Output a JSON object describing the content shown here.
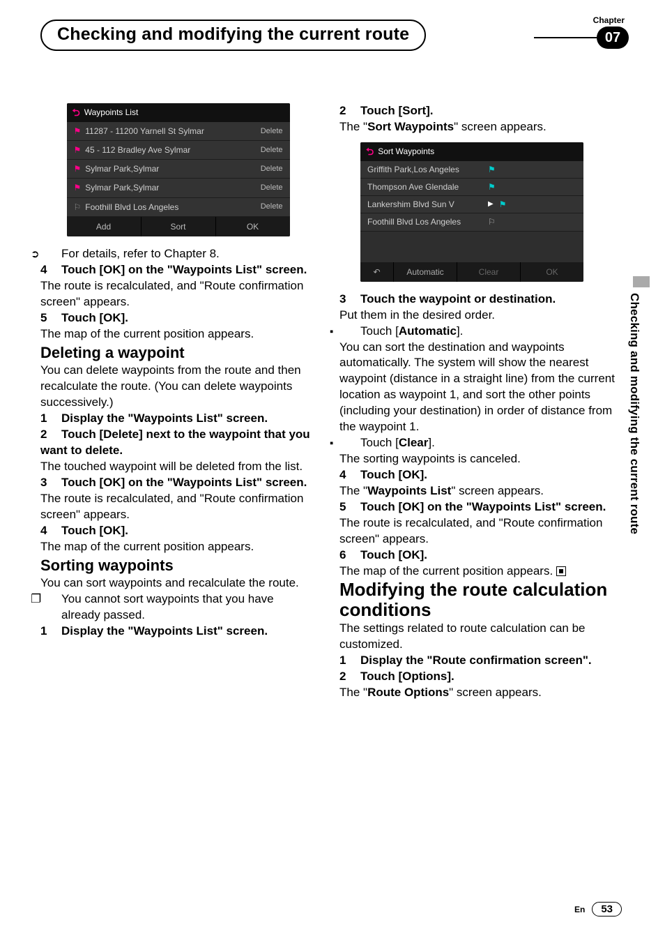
{
  "header": {
    "chapter_label": "Chapter",
    "chapter_number": "07",
    "title": "Checking and modifying the current route"
  },
  "side_tab": "Checking and modifying the current route",
  "footer": {
    "lang": "En",
    "page": "53"
  },
  "shot_waypoints": {
    "title": "Waypoints List",
    "rows": [
      {
        "name": "11287 - 11200 Yarnell St Sylmar",
        "action": "Delete",
        "flag": "flag"
      },
      {
        "name": "45 - 112 Bradley Ave Sylmar",
        "action": "Delete",
        "flag": "flag"
      },
      {
        "name": "Sylmar Park,Sylmar",
        "action": "Delete",
        "flag": "flag"
      },
      {
        "name": "Sylmar Park,Sylmar",
        "action": "Delete",
        "flag": "flag"
      },
      {
        "name": "Foothill Blvd Los Angeles",
        "action": "Delete",
        "flag": "check"
      }
    ],
    "foot": {
      "a": "Add",
      "b": "Sort",
      "c": "OK"
    }
  },
  "shot_sort": {
    "title": "Sort Waypoints",
    "rows": [
      {
        "name": "Griffith Park,Los Angeles",
        "flag": "flag"
      },
      {
        "name": "Thompson Ave Glendale",
        "flag": "flag"
      },
      {
        "name": "Lankershim Blvd Sun V",
        "tri": true,
        "flag": "flag"
      },
      {
        "name": "Foothill Blvd Los Angeles",
        "flag": "check"
      }
    ],
    "foot": {
      "back": "↶",
      "a": "Automatic",
      "b": "Clear",
      "c": "OK"
    }
  },
  "left": {
    "ref_line": "For details, refer to Chapter 8.",
    "s4_h": "Touch [OK] on the \"Waypoints List\" screen.",
    "s4_h_pre": "4",
    "s4_p": "The route is recalculated, and \"Route confirmation screen\" appears.",
    "s5_h_pre": "5",
    "s5_h": "Touch [OK].",
    "s5_p": "The map of the current position appears.",
    "del_h": "Deleting a waypoint",
    "del_p": "You can delete waypoints from the route and then recalculate the route. (You can delete waypoints successively.)",
    "d1_pre": "1",
    "d1_h": "Display the \"Waypoints List\" screen.",
    "d2_pre": "2",
    "d2_h": "Touch [Delete] next to the waypoint that you want to delete.",
    "d2_p": "The touched waypoint will be deleted from the list.",
    "d3_pre": "3",
    "d3_h": "Touch [OK] on the \"Waypoints List\" screen.",
    "d3_p": "The route is recalculated, and \"Route confirmation screen\" appears.",
    "d4_pre": "4",
    "d4_h": "Touch [OK].",
    "d4_p": "The map of the current position appears.",
    "sort_h": "Sorting waypoints",
    "sort_p": "You can sort waypoints and recalculate the route.",
    "sort_note": "You cannot sort waypoints that you have already passed.",
    "so1_pre": "1",
    "so1_h": "Display the \"Waypoints List\" screen."
  },
  "right": {
    "r2_pre": "2",
    "r2_h": "Touch [Sort].",
    "r2_p_a": "The \"",
    "r2_p_b": "Sort Waypoints",
    "r2_p_c": "\" screen appears.",
    "r3_pre": "3",
    "r3_h": "Touch the waypoint or destination.",
    "r3_p": "Put them in the desired order.",
    "auto_lbl_a": "Touch [",
    "auto_lbl_b": "Automatic",
    "auto_lbl_c": "].",
    "auto_p": "You can sort the destination and waypoints automatically. The system will show the nearest waypoint (distance in a straight line) from the current location as waypoint 1, and sort the other points (including your destination) in order of distance from the waypoint 1.",
    "clear_lbl_a": "Touch [",
    "clear_lbl_b": "Clear",
    "clear_lbl_c": "].",
    "clear_p": "The sorting waypoints is canceled.",
    "r4_pre": "4",
    "r4_h": "Touch [OK].",
    "r4_p_a": "The \"",
    "r4_p_b": "Waypoints List",
    "r4_p_c": "\" screen appears.",
    "r5_pre": "5",
    "r5_h": "Touch [OK] on the \"Waypoints List\" screen.",
    "r5_p": "The route is recalculated, and \"Route confirmation screen\" appears.",
    "r6_pre": "6",
    "r6_h": "Touch [OK].",
    "r6_p": "The map of the current position appears.",
    "mod_h": "Modifying the route calculation conditions",
    "mod_p": "The settings related to route calculation can be customized.",
    "m1_pre": "1",
    "m1_h": "Display the \"Route confirmation screen\".",
    "m2_pre": "2",
    "m2_h": "Touch [Options].",
    "m2_p_a": "The \"",
    "m2_p_b": "Route Options",
    "m2_p_c": "\" screen appears."
  }
}
